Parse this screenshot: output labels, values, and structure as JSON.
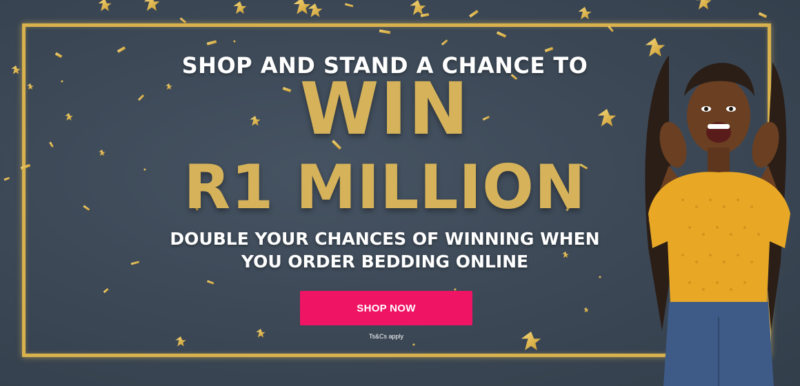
{
  "banner": {
    "headline_top": "SHOP AND STAND A CHANCE TO",
    "headline_win": "WIN",
    "headline_amount": "R1 MILLION",
    "subheadline_line1": "DOUBLE YOUR CHANCES OF WINNING WHEN",
    "subheadline_line2": "YOU ORDER BEDDING ONLINE",
    "cta_label": "SHOP NOW",
    "terms": "Ts&Cs apply"
  },
  "colors": {
    "background": "#3d4957",
    "gold": "#d6b35a",
    "frame": "#d9b24e",
    "cta": "#ef1464",
    "text": "#ffffff"
  },
  "decorations": {
    "icons": [
      "gold-star-icon",
      "gold-confetti-icon"
    ],
    "image": "smiling-woman-yellow-top"
  }
}
